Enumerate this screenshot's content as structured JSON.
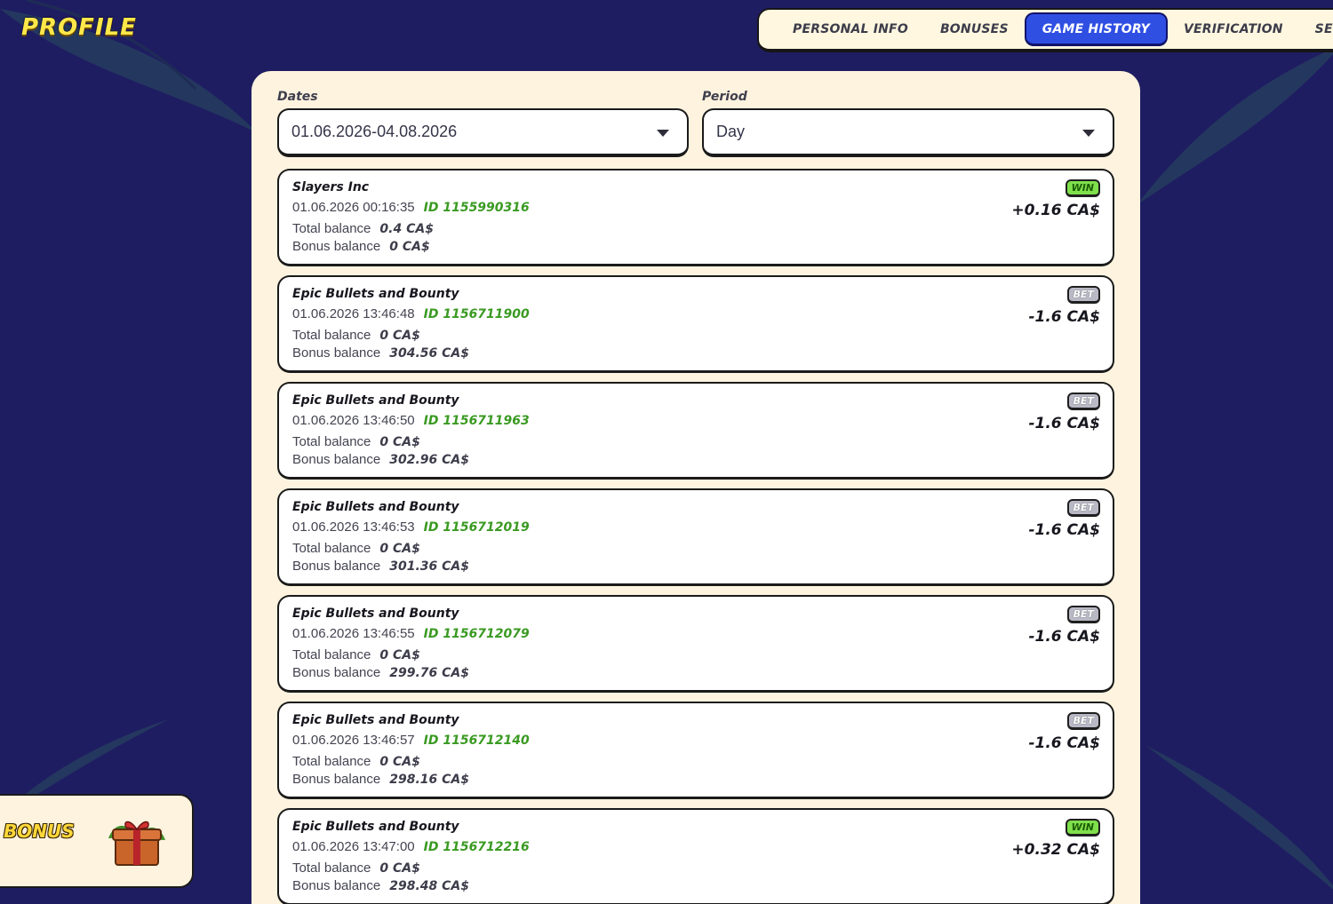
{
  "header": {
    "title": "PROFILE",
    "tabs": [
      {
        "label": "PERSONAL INFO",
        "active": false
      },
      {
        "label": "BONUSES",
        "active": false
      },
      {
        "label": "GAME HISTORY",
        "active": true
      },
      {
        "label": "VERIFICATION",
        "active": false
      },
      {
        "label": "SECURI",
        "active": false
      }
    ]
  },
  "filters": {
    "dates_label": "Dates",
    "dates_value": "01.06.2026-04.08.2026",
    "period_label": "Period",
    "period_value": "Day"
  },
  "history": {
    "total_label": "Total balance",
    "bonus_label": "Bonus balance",
    "items": [
      {
        "game": "Slayers Inc",
        "datetime": "01.06.2026 00:16:35",
        "id": "ID 1155990316",
        "total": "0.4 CA$",
        "bonus": "0 CA$",
        "badge": "WIN",
        "amount": "+0.16 CA$"
      },
      {
        "game": "Epic Bullets and Bounty",
        "datetime": "01.06.2026 13:46:48",
        "id": "ID 1156711900",
        "total": "0 CA$",
        "bonus": "304.56 CA$",
        "badge": "BET",
        "amount": "-1.6 CA$"
      },
      {
        "game": "Epic Bullets and Bounty",
        "datetime": "01.06.2026 13:46:50",
        "id": "ID 1156711963",
        "total": "0 CA$",
        "bonus": "302.96 CA$",
        "badge": "BET",
        "amount": "-1.6 CA$"
      },
      {
        "game": "Epic Bullets and Bounty",
        "datetime": "01.06.2026 13:46:53",
        "id": "ID 1156712019",
        "total": "0 CA$",
        "bonus": "301.36 CA$",
        "badge": "BET",
        "amount": "-1.6 CA$"
      },
      {
        "game": "Epic Bullets and Bounty",
        "datetime": "01.06.2026 13:46:55",
        "id": "ID 1156712079",
        "total": "0 CA$",
        "bonus": "299.76 CA$",
        "badge": "BET",
        "amount": "-1.6 CA$"
      },
      {
        "game": "Epic Bullets and Bounty",
        "datetime": "01.06.2026 13:46:57",
        "id": "ID 1156712140",
        "total": "0 CA$",
        "bonus": "298.16 CA$",
        "badge": "BET",
        "amount": "-1.6 CA$"
      },
      {
        "game": "Epic Bullets and Bounty",
        "datetime": "01.06.2026 13:47:00",
        "id": "ID 1156712216",
        "total": "0 CA$",
        "bonus": "298.48 CA$",
        "badge": "WIN",
        "amount": "+0.32 CA$"
      }
    ]
  },
  "bonus_widget": {
    "label": "BONUS",
    "icon": "gift-box-icon"
  },
  "colors": {
    "background": "#1f1d62",
    "accent_title": "#ffe84a",
    "active_tab": "#2f4fe3",
    "panel": "#fdf3df",
    "win_badge": "#7fe04b",
    "bet_badge": "#b9b9c6",
    "tx_id": "#3a9a22"
  }
}
